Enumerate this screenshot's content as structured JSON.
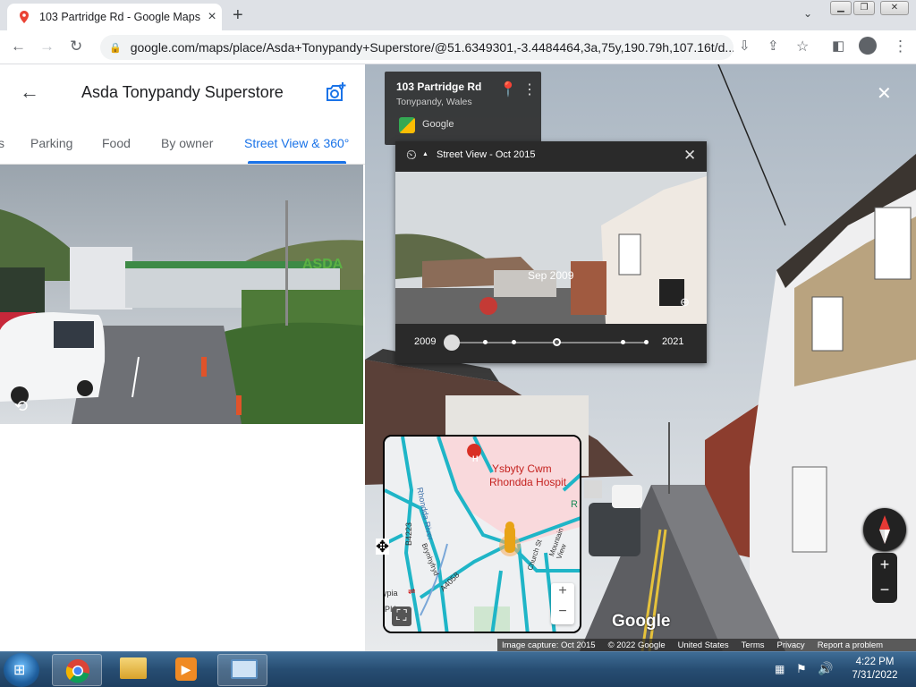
{
  "browser": {
    "tab_title": "103 Partridge Rd - Google Maps",
    "tab_close": "×",
    "new_tab": "+",
    "url": "google.com/maps/place/Asda+Tonypandy+Superstore/@51.6349301,-3.4484464,3a,75y,190.79h,107.16t/d..."
  },
  "panel": {
    "title": "Asda Tonypandy Superstore",
    "tabs": [
      "s",
      "Parking",
      "Food",
      "By owner",
      "Street View & 360°"
    ],
    "active_tab": "Street View & 360°"
  },
  "streetview": {
    "address_line1": "103 Partridge Rd",
    "address_line2": "Tonypandy, Wales",
    "provider": "Google",
    "timemachine_header": "Street View - Oct 2015",
    "thumb_date": "Sep 2009",
    "year_start": "2009",
    "year_end": "2021",
    "watermark": "Google",
    "footer": [
      "Image capture: Oct 2015",
      "© 2022 Google",
      "United States",
      "Terms",
      "Privacy",
      "Report a problem"
    ],
    "zoom_in": "+",
    "zoom_out": "−",
    "close": "✕"
  },
  "minimap": {
    "hospital_line1": "Ysbyty Cwm",
    "hospital_line2": "Rhondda Hospit",
    "river": "Rhondda River",
    "road1": "B4223",
    "road2": "A4058",
    "street1": "Church St",
    "street2": "Mountain View",
    "street3": "Brynhyfryd",
    "place": "ypia",
    "place2": "PIA",
    "edge_label": "R",
    "zoom_in": "+",
    "zoom_out": "−"
  },
  "taskbar": {
    "time": "4:22 PM",
    "date": "7/31/2022"
  },
  "colors": {
    "accent": "#1a73e8",
    "map_roads": "#1fb5c7",
    "taskbar": "#274d72"
  }
}
